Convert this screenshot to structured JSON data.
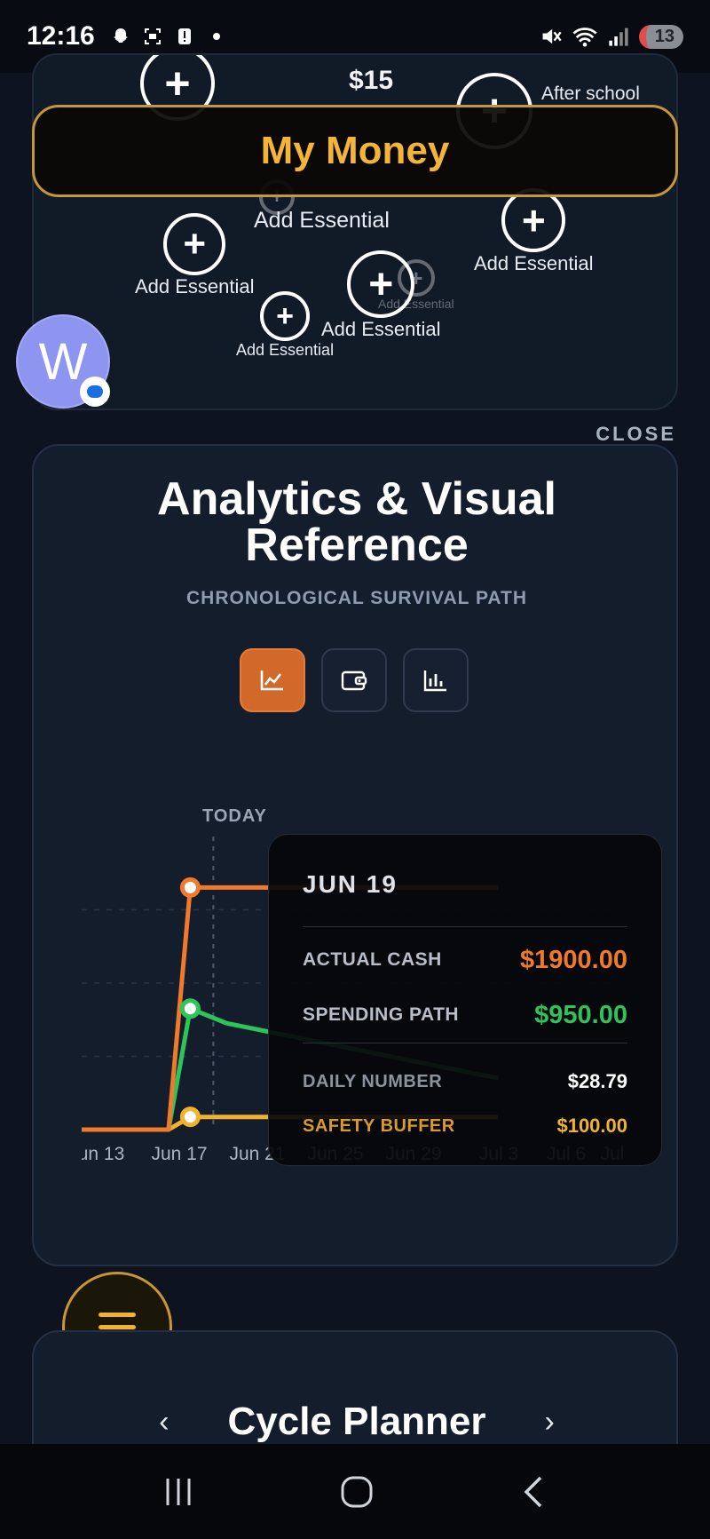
{
  "status_bar": {
    "time": "12:16",
    "battery": "13"
  },
  "top_card": {
    "price": "$15",
    "after_school": "After school",
    "add_essential": "Add Essential",
    "header_title": "My Money"
  },
  "avatar": {
    "initial": "W"
  },
  "close_label": "CLOSE",
  "analytics": {
    "title_line1": "Analytics & Visual",
    "title_line2": "Reference",
    "subtitle": "CHRONOLOGICAL SURVIVAL PATH",
    "tabs": [
      {
        "icon": "line-chart-icon",
        "active": true
      },
      {
        "icon": "wallet-icon",
        "active": false
      },
      {
        "icon": "bar-chart-icon",
        "active": false
      }
    ],
    "today_label": "TODAY",
    "x_ticks": [
      "un 13",
      "Jun 17",
      "Jun 21",
      "Jun 25",
      "Jun 29",
      "Jul 3",
      "Jul 6",
      "Jul"
    ],
    "tooltip": {
      "date": "JUN 19",
      "actual_cash_label": "ACTUAL CASH",
      "actual_cash_value": "$1900.00",
      "spending_path_label": "SPENDING PATH",
      "spending_path_value": "$950.00",
      "daily_number_label": "DAILY NUMBER",
      "daily_number_value": "$28.79",
      "safety_buffer_label": "SAFETY BUFFER",
      "safety_buffer_value": "$100.00"
    },
    "colors": {
      "actual_cash": "#f07a2b",
      "spending_path": "#2ec45a",
      "safety_buffer": "#f2b230"
    }
  },
  "chart_data": {
    "type": "line",
    "x": [
      "Jun 13",
      "Jun 17",
      "Jun 19",
      "Jun 21",
      "Jun 25",
      "Jun 29",
      "Jul 3",
      "Jul 6"
    ],
    "series": [
      {
        "name": "ACTUAL CASH",
        "values": [
          0,
          0,
          1900,
          1900,
          1900,
          1900,
          1900,
          1900
        ]
      },
      {
        "name": "SPENDING PATH",
        "values": [
          0,
          0,
          950,
          835,
          720,
          604,
          489,
          403
        ]
      },
      {
        "name": "SAFETY BUFFER",
        "values": [
          0,
          0,
          100,
          100,
          100,
          100,
          100,
          100
        ]
      }
    ],
    "highlight_x": "Jun 19",
    "grid": true
  },
  "cycle_planner": {
    "title": "Cycle Planner"
  }
}
